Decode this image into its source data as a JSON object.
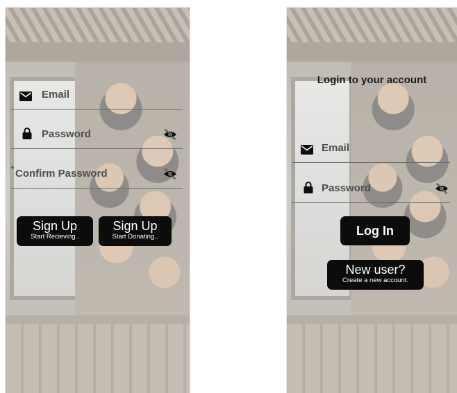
{
  "signup": {
    "email_label": "Email",
    "password_label": "Password",
    "confirm_label": "Confirm Password",
    "confirm_marker": "*",
    "receive_button": {
      "main": "Sign Up",
      "sub": "Start Recieving.."
    },
    "donate_button": {
      "main": "Sign Up",
      "sub": "Start Donating.."
    }
  },
  "login": {
    "title": "Login to your account",
    "email_label": "Email",
    "password_label": "Password",
    "login_button": "Log In",
    "new_user_button": {
      "main": "New user?",
      "sub": "Create a new account."
    }
  },
  "icons": {
    "email": "envelope-icon",
    "password": "lock-icon",
    "visibility": "eye-off-icon"
  },
  "colors": {
    "button_bg": "#0c0c0c",
    "button_text": "#ffffff",
    "field_label": "#4d4d4d",
    "title": "#1a1a1a"
  }
}
